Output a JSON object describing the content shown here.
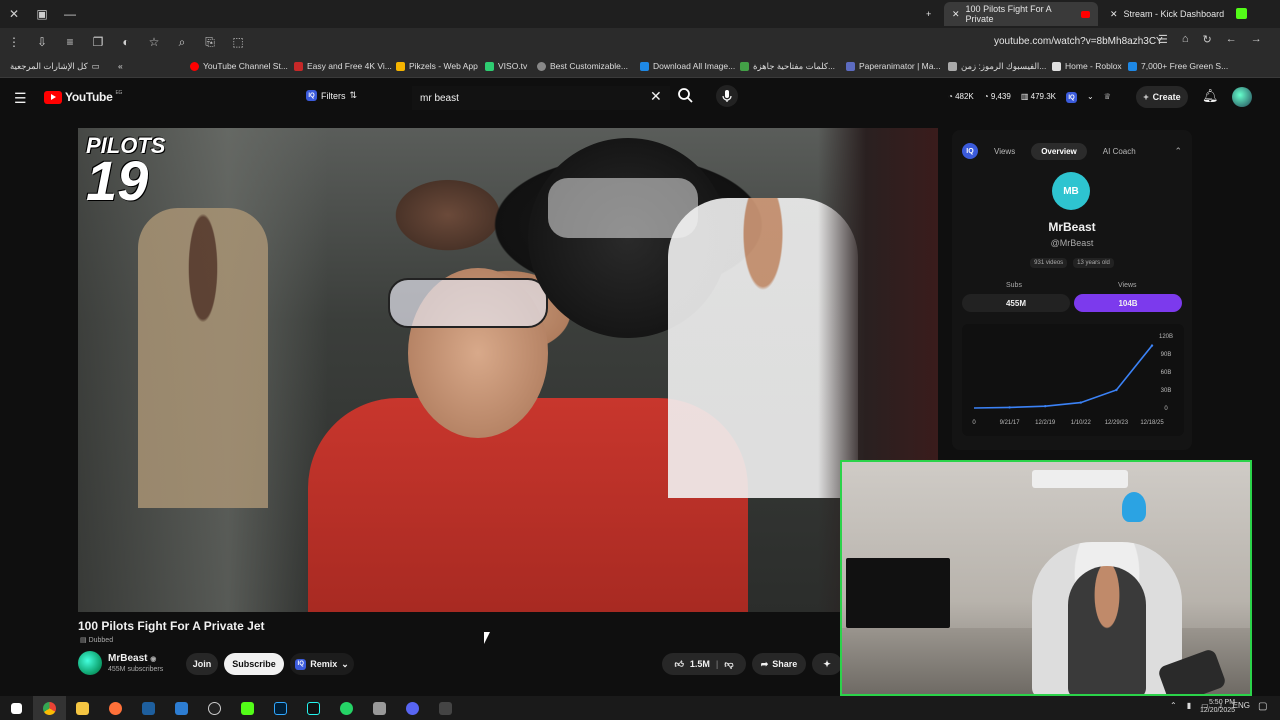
{
  "browser": {
    "tabs": [
      {
        "title": "100 Pilots Fight For A Private",
        "active": true
      },
      {
        "title": "Stream - Kick Dashboard",
        "active": false
      }
    ],
    "url": "youtube.com/watch?v=8bMh8azh3CY",
    "bookmarks": [
      {
        "label": "كل الإشارات المرجعية",
        "color": "#888888"
      },
      {
        "label": "YouTube Channel St...",
        "color": "#ff0000"
      },
      {
        "label": "Easy and Free 4K Vi...",
        "color": "#c62828"
      },
      {
        "label": "Pikzels - Web App",
        "color": "#f5b400"
      },
      {
        "label": "VISO.tv",
        "color": "#2ecc71"
      },
      {
        "label": "Best Customizable...",
        "color": "#888888"
      },
      {
        "label": "Download All Image...",
        "color": "#1e88e5"
      },
      {
        "label": "كلمات مفتاحية جاهزة...",
        "color": "#43a047"
      },
      {
        "label": "Paperanimator | Ma...",
        "color": "#5c6bc0"
      },
      {
        "label": "الفيسبوك الرموز: زمن...",
        "color": "#aaaaaa"
      },
      {
        "label": "Home - Roblox",
        "color": "#e0e0e0"
      },
      {
        "label": "7,000+ Free Green S...",
        "color": "#1e88e5"
      }
    ]
  },
  "youtube": {
    "logo_text": "YouTube",
    "logo_region": "EG",
    "filters_label": "Filters",
    "search_value": "mr beast",
    "stats": [
      "482K",
      "9,439",
      "479.3K"
    ],
    "create_label": "Create"
  },
  "video": {
    "overlay_line1": "PILOTS",
    "overlay_line2": "19",
    "title": "100 Pilots Fight For A Private Jet",
    "dubbed": "Dubbed",
    "channel": "MrBeast",
    "subscribers": "455M subscribers",
    "join_label": "Join",
    "subscribe_label": "Subscribe",
    "remix_label": "Remix",
    "likes": "1.5M",
    "share_label": "Share"
  },
  "side_panel": {
    "tabs": [
      "Views",
      "Overview",
      "AI Coach"
    ],
    "active_tab": "Overview",
    "channel_name": "MrBeast",
    "handle": "@MrBeast",
    "videos": "931 videos",
    "age": "13 years old",
    "subs_label": "Subs",
    "subs_value": "455M",
    "views_label": "Views",
    "views_value": "104B",
    "accent": "#7c3aed"
  },
  "chart_data": {
    "type": "line",
    "x": [
      "9/21/17",
      "12/2/19",
      "1/10/22",
      "12/29/23",
      "12/18/25"
    ],
    "values": [
      1,
      3,
      9,
      30,
      104
    ],
    "ytick_labels": [
      "0",
      "30B",
      "60B",
      "90B",
      "120B"
    ],
    "xtick_labels": [
      "0",
      "9/21/17",
      "12/2/19",
      "1/10/22",
      "12/29/23",
      "12/18/25"
    ],
    "ylim": [
      0,
      120
    ],
    "color": "#3b82f6"
  },
  "taskbar": {
    "language": "ENG",
    "time": "5:50 PM",
    "date": "12/20/2025"
  }
}
